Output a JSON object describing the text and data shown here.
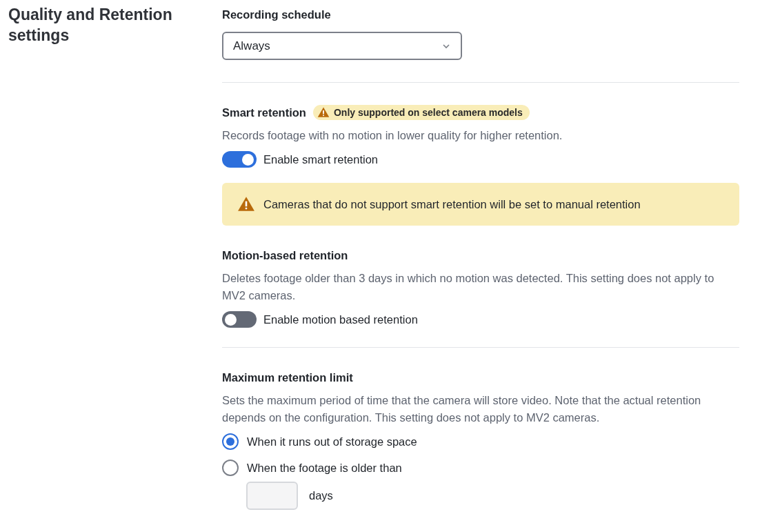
{
  "page_title": "Quality and Retention settings",
  "recording_schedule": {
    "label": "Recording schedule",
    "value": "Always"
  },
  "smart_retention": {
    "title": "Smart retention",
    "badge": "Only supported on select camera models",
    "description": "Records footage with no motion in lower quality for higher retention.",
    "toggle": {
      "label": "Enable smart retention",
      "on": true
    },
    "alert": "Cameras that do not support smart retention will be set to manual retention"
  },
  "motion_retention": {
    "title": "Motion-based retention",
    "description": "Deletes footage older than 3 days in which no motion was detected. This setting does not apply to MV2 cameras.",
    "toggle": {
      "label": "Enable motion based retention",
      "on": false
    }
  },
  "max_retention": {
    "title": "Maximum retention limit",
    "description": "Sets the maximum period of time that the camera will store video. Note that the actual retention depends on the configuration. This setting does not apply to MV2 cameras.",
    "options": [
      {
        "label": "When it runs out of storage space",
        "selected": true
      },
      {
        "label": "When the footage is older than",
        "selected": false
      }
    ],
    "days_unit": "days"
  }
}
